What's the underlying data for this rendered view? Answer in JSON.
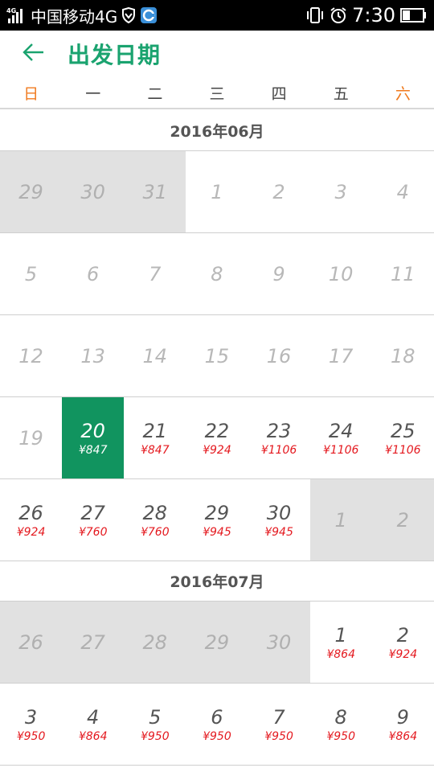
{
  "statusbar": {
    "carrier": "中国移动4G",
    "time": "7:30",
    "network_label": "4G"
  },
  "header": {
    "title": "出发日期",
    "back_icon": "arrow-left-icon"
  },
  "weekdays": [
    "日",
    "一",
    "二",
    "三",
    "四",
    "五",
    "六"
  ],
  "colors": {
    "accent_green": "#1aa36f",
    "selected_green": "#11945f",
    "price_red": "#e4191f",
    "weekend_orange": "#f07a1e",
    "disabled_grey_bg": "#e1e1e1"
  },
  "months": [
    {
      "label": "2016年06月",
      "weeks": [
        [
          {
            "day": "29",
            "state": "outside",
            "price": ""
          },
          {
            "day": "30",
            "state": "outside",
            "price": ""
          },
          {
            "day": "31",
            "state": "outside",
            "price": ""
          },
          {
            "day": "1",
            "state": "past",
            "price": ""
          },
          {
            "day": "2",
            "state": "past",
            "price": ""
          },
          {
            "day": "3",
            "state": "past",
            "price": ""
          },
          {
            "day": "4",
            "state": "past",
            "price": ""
          }
        ],
        [
          {
            "day": "5",
            "state": "past",
            "price": ""
          },
          {
            "day": "6",
            "state": "past",
            "price": ""
          },
          {
            "day": "7",
            "state": "past",
            "price": ""
          },
          {
            "day": "8",
            "state": "past",
            "price": ""
          },
          {
            "day": "9",
            "state": "past",
            "price": ""
          },
          {
            "day": "10",
            "state": "past",
            "price": ""
          },
          {
            "day": "11",
            "state": "past",
            "price": ""
          }
        ],
        [
          {
            "day": "12",
            "state": "past",
            "price": ""
          },
          {
            "day": "13",
            "state": "past",
            "price": ""
          },
          {
            "day": "14",
            "state": "past",
            "price": ""
          },
          {
            "day": "15",
            "state": "past",
            "price": ""
          },
          {
            "day": "16",
            "state": "past",
            "price": ""
          },
          {
            "day": "17",
            "state": "past",
            "price": ""
          },
          {
            "day": "18",
            "state": "past",
            "price": ""
          }
        ],
        [
          {
            "day": "19",
            "state": "past",
            "price": ""
          },
          {
            "day": "20",
            "state": "selected",
            "price": "¥847"
          },
          {
            "day": "21",
            "state": "available",
            "price": "¥847"
          },
          {
            "day": "22",
            "state": "available",
            "price": "¥924"
          },
          {
            "day": "23",
            "state": "available",
            "price": "¥1106"
          },
          {
            "day": "24",
            "state": "available",
            "price": "¥1106"
          },
          {
            "day": "25",
            "state": "available",
            "price": "¥1106"
          }
        ],
        [
          {
            "day": "26",
            "state": "available",
            "price": "¥924"
          },
          {
            "day": "27",
            "state": "available",
            "price": "¥760"
          },
          {
            "day": "28",
            "state": "available",
            "price": "¥760"
          },
          {
            "day": "29",
            "state": "available",
            "price": "¥945"
          },
          {
            "day": "30",
            "state": "available",
            "price": "¥945"
          },
          {
            "day": "1",
            "state": "outside",
            "price": ""
          },
          {
            "day": "2",
            "state": "outside",
            "price": ""
          }
        ]
      ]
    },
    {
      "label": "2016年07月",
      "weeks": [
        [
          {
            "day": "26",
            "state": "outside",
            "price": ""
          },
          {
            "day": "27",
            "state": "outside",
            "price": ""
          },
          {
            "day": "28",
            "state": "outside",
            "price": ""
          },
          {
            "day": "29",
            "state": "outside",
            "price": ""
          },
          {
            "day": "30",
            "state": "outside",
            "price": ""
          },
          {
            "day": "1",
            "state": "available",
            "price": "¥864"
          },
          {
            "day": "2",
            "state": "available",
            "price": "¥924"
          }
        ],
        [
          {
            "day": "3",
            "state": "available",
            "price": "¥950"
          },
          {
            "day": "4",
            "state": "available",
            "price": "¥864"
          },
          {
            "day": "5",
            "state": "available",
            "price": "¥950"
          },
          {
            "day": "6",
            "state": "available",
            "price": "¥950"
          },
          {
            "day": "7",
            "state": "available",
            "price": "¥950"
          },
          {
            "day": "8",
            "state": "available",
            "price": "¥950"
          },
          {
            "day": "9",
            "state": "available",
            "price": "¥864"
          }
        ]
      ]
    }
  ]
}
